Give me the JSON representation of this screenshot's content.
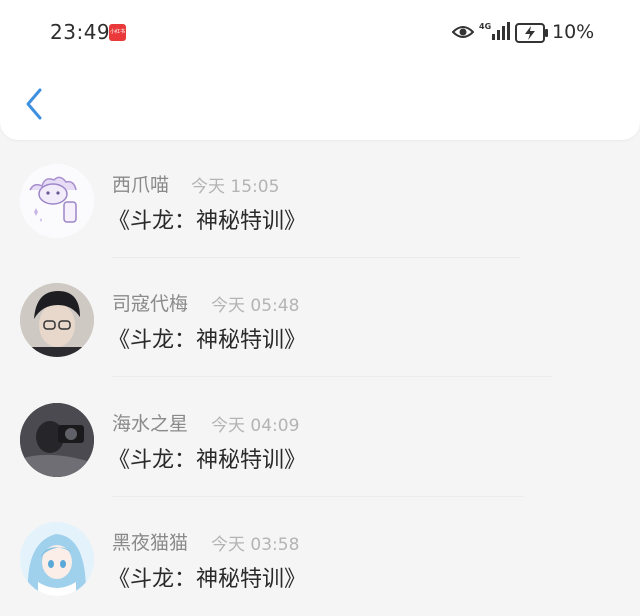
{
  "status_bar": {
    "time": "23:49",
    "app_badge": "小红书",
    "network": "4G",
    "battery": "10%"
  },
  "conversations": [
    {
      "name": "西爪喵",
      "time": "今天 15:05",
      "message": "《斗龙：神秘特训》"
    },
    {
      "name": "司寇代梅",
      "time": "今天 05:48",
      "message": "《斗龙：神秘特训》"
    },
    {
      "name": "海水之星",
      "time": "今天 04:09",
      "message": "《斗龙：神秘特训》"
    },
    {
      "name": "黑夜猫猫",
      "time": "今天 03:58",
      "message": "《斗龙：神秘特训》"
    }
  ],
  "colors": {
    "accent": "#3d8fe0",
    "badge": "#e9393a"
  }
}
